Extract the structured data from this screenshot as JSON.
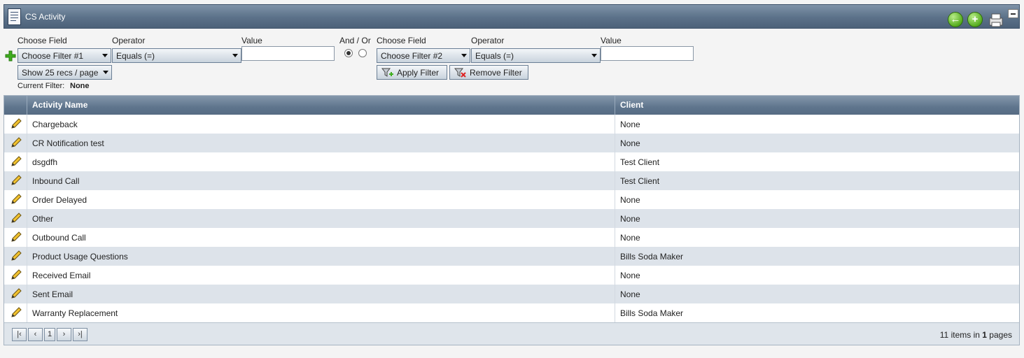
{
  "window": {
    "title": "CS Activity"
  },
  "filters": {
    "choose_field_label": "Choose Field",
    "operator_label": "Operator",
    "value_label": "Value",
    "and_or_label": "And / Or",
    "filter1": {
      "field": "Choose Filter #1",
      "operator": "Equals (=)",
      "value": ""
    },
    "filter2": {
      "field": "Choose Filter #2",
      "operator": "Equals (=)",
      "value": ""
    },
    "and_or_selected": "and",
    "page_size": "Show 25 recs / page",
    "current_filter_label": "Current Filter:",
    "current_filter_value": "None",
    "apply_label": "Apply Filter",
    "remove_label": "Remove Filter"
  },
  "grid": {
    "columns": [
      "Activity Name",
      "Client"
    ],
    "rows": [
      {
        "name": "Chargeback",
        "client": "None"
      },
      {
        "name": "CR Notification test",
        "client": "None"
      },
      {
        "name": "dsgdfh",
        "client": "Test Client"
      },
      {
        "name": "Inbound Call",
        "client": "Test Client"
      },
      {
        "name": "Order Delayed",
        "client": "None"
      },
      {
        "name": "Other",
        "client": "None"
      },
      {
        "name": "Outbound Call",
        "client": "None"
      },
      {
        "name": "Product Usage Questions",
        "client": "Bills Soda Maker"
      },
      {
        "name": "Received Email",
        "client": "None"
      },
      {
        "name": "Sent Email",
        "client": "None"
      },
      {
        "name": "Warranty Replacement",
        "client": "Bills Soda Maker"
      }
    ]
  },
  "pager": {
    "current_page": "1",
    "items_count": "11",
    "items_text": "items in",
    "pages_count": "1",
    "pages_text": "pages"
  },
  "colors": {
    "header": "#5f758d",
    "accent_green": "#56ad20",
    "alt_row": "#dde3ea"
  }
}
